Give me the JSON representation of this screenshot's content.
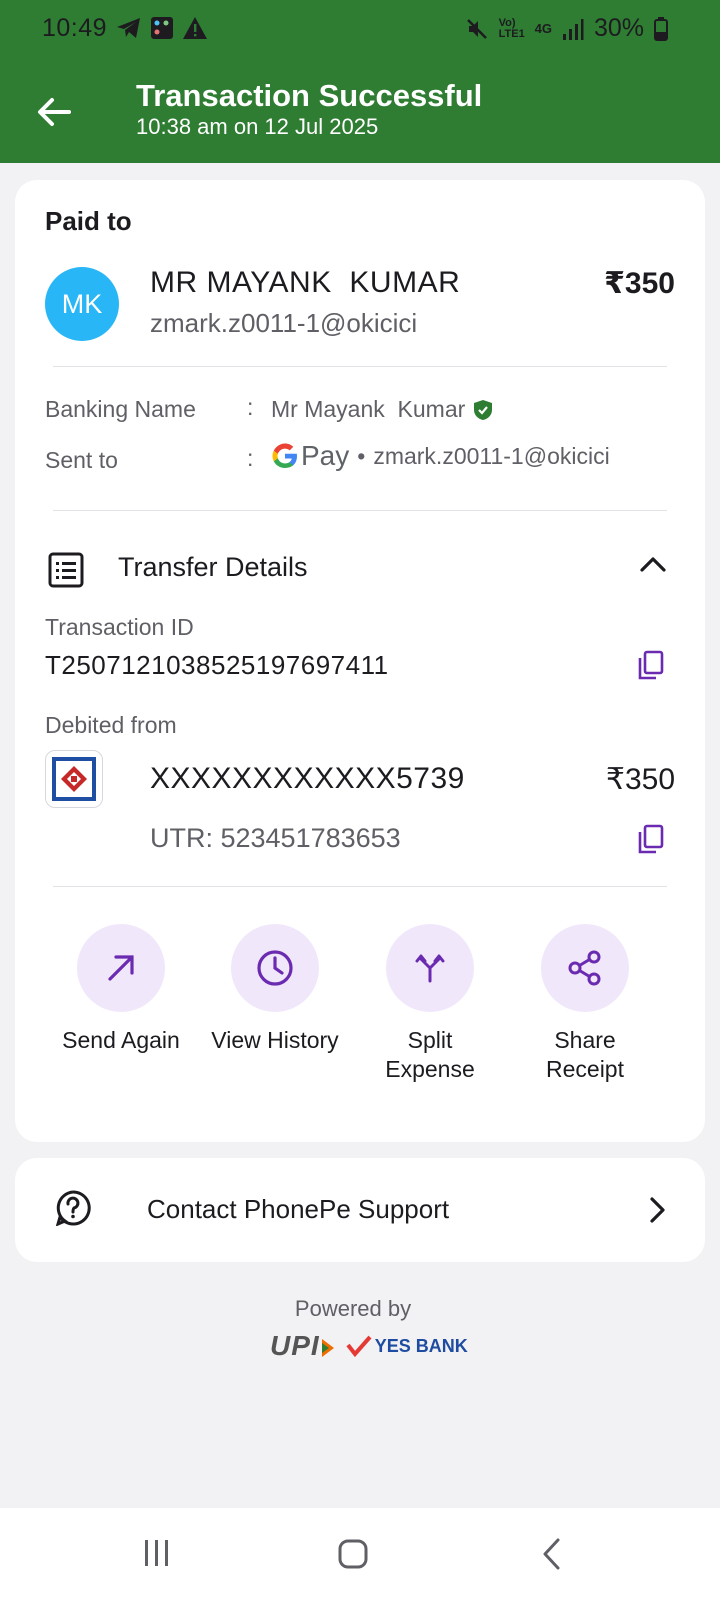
{
  "status_bar": {
    "time": "10:49",
    "battery": "30%",
    "icons": [
      "telegram-icon",
      "app-notification-icon",
      "warning-icon",
      "mute-icon",
      "volte-icon",
      "4g-icon",
      "signal-icon",
      "battery-icon"
    ],
    "network_volte": "Vo) LTE1",
    "network_gen": "4G"
  },
  "header": {
    "title": "Transaction Successful",
    "subtitle": "10:38 am on 12 Jul 2025",
    "background_color": "#2e7d32"
  },
  "payment": {
    "paid_to_label": "Paid to",
    "avatar_initials": "MK",
    "avatar_color": "#29b6f6",
    "payee_name": "MR MAYANK  KUMAR",
    "payee_upi": "zmark.z0011-1@okicici",
    "amount": "₹350"
  },
  "details": {
    "banking_name_label": "Banking Name",
    "banking_name_value": "Mr Mayank  Kumar",
    "sent_to_label": "Sent to",
    "colon": ":",
    "sent_to_app": "Pay",
    "separator": "•",
    "sent_to_upi": "zmark.z0011-1@okicici"
  },
  "transfer": {
    "section_title": "Transfer Details",
    "transaction_id_label": "Transaction ID",
    "transaction_id": "T2507121038525197697411",
    "debited_from_label": "Debited from",
    "account_number": "XXXXXXXXXXXX5739",
    "debit_amount": "₹350",
    "utr": "UTR: 523451783653"
  },
  "actions": [
    {
      "label": "Send Again",
      "icon": "arrow-up-right-icon"
    },
    {
      "label": "View History",
      "icon": "clock-icon"
    },
    {
      "label": "Split Expense",
      "icon": "split-icon"
    },
    {
      "label": "Share Receipt",
      "icon": "share-icon"
    }
  ],
  "support": {
    "label": "Contact PhonePe Support"
  },
  "footer": {
    "powered_by": "Powered by",
    "upi_text": "UPI",
    "bank_text": "YES BANK"
  },
  "accent_color": "#6a2bb0"
}
